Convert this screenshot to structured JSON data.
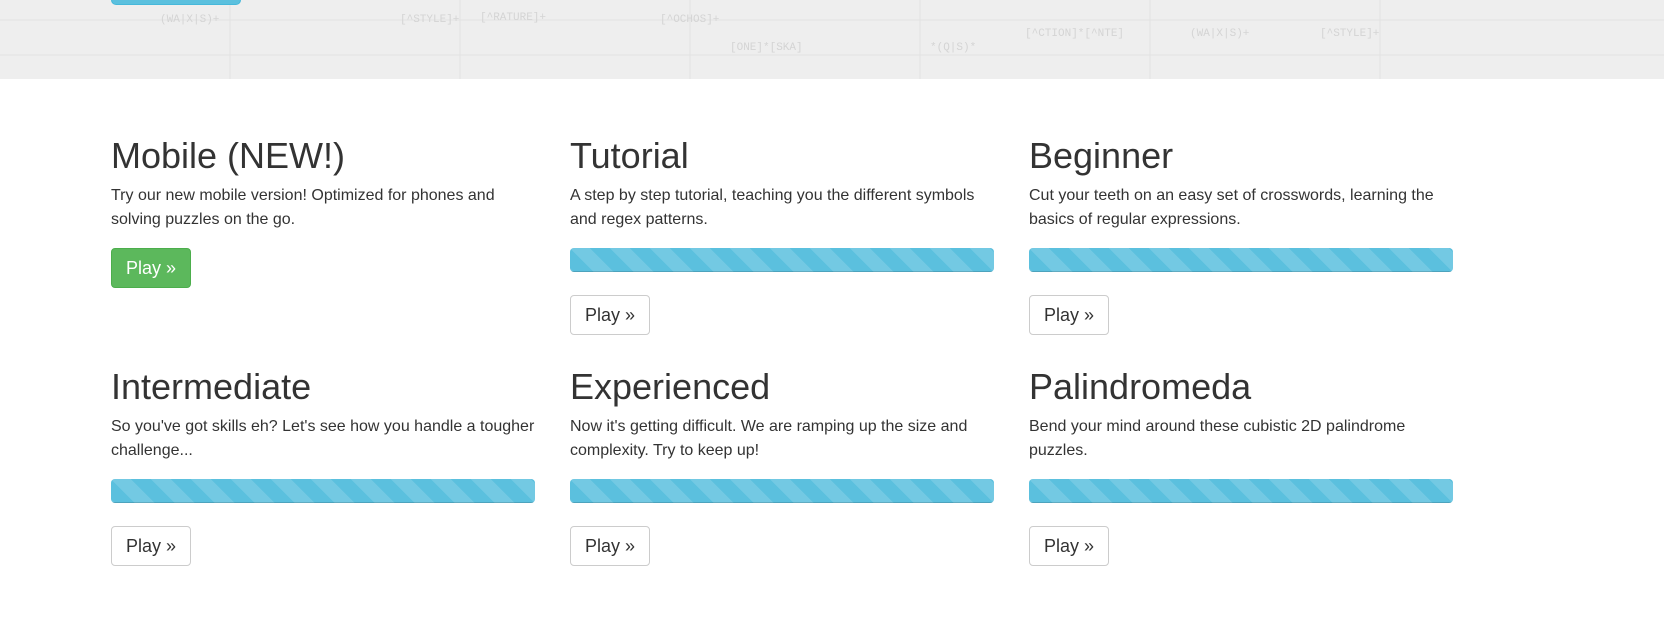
{
  "colors": {
    "accent_info": "#5bc0de",
    "success": "#5cb85c",
    "text": "#333333",
    "header_bg": "#eeeeee"
  },
  "header": {
    "background_snippets": [
      "(WA|X|S)+",
      "[^STYLE]+",
      "[^RATURE]+",
      "[^OCHOS]+",
      "[ONE]*[SKA]",
      "*(Q|S)*",
      "[^CTION]*[^NTE]"
    ]
  },
  "levels": [
    {
      "title": "Mobile (NEW!)",
      "description": "Try our new mobile version! Optimized for phones and solving puzzles on the go.",
      "button_label": "Play »",
      "button_style": "success"
    },
    {
      "title": "Tutorial",
      "description": "A step by step tutorial, teaching you the different symbols and regex patterns.",
      "progress_percent": 100,
      "button_label": "Play »",
      "button_style": "default"
    },
    {
      "title": "Beginner",
      "description": "Cut your teeth on an easy set of crosswords, learning the basics of regular expressions.",
      "progress_percent": 100,
      "button_label": "Play »",
      "button_style": "default"
    },
    {
      "title": "Intermediate",
      "description": "So you've got skills eh? Let's see how you handle a tougher challenge...",
      "progress_percent": 100,
      "button_label": "Play »",
      "button_style": "default"
    },
    {
      "title": "Experienced",
      "description": "Now it's getting difficult. We are ramping up the size and complexity. Try to keep up!",
      "progress_percent": 100,
      "button_label": "Play »",
      "button_style": "default"
    },
    {
      "title": "Palindromeda",
      "description": "Bend your mind around these cubistic 2D palindrome puzzles.",
      "progress_percent": 100,
      "button_label": "Play »",
      "button_style": "default"
    }
  ]
}
